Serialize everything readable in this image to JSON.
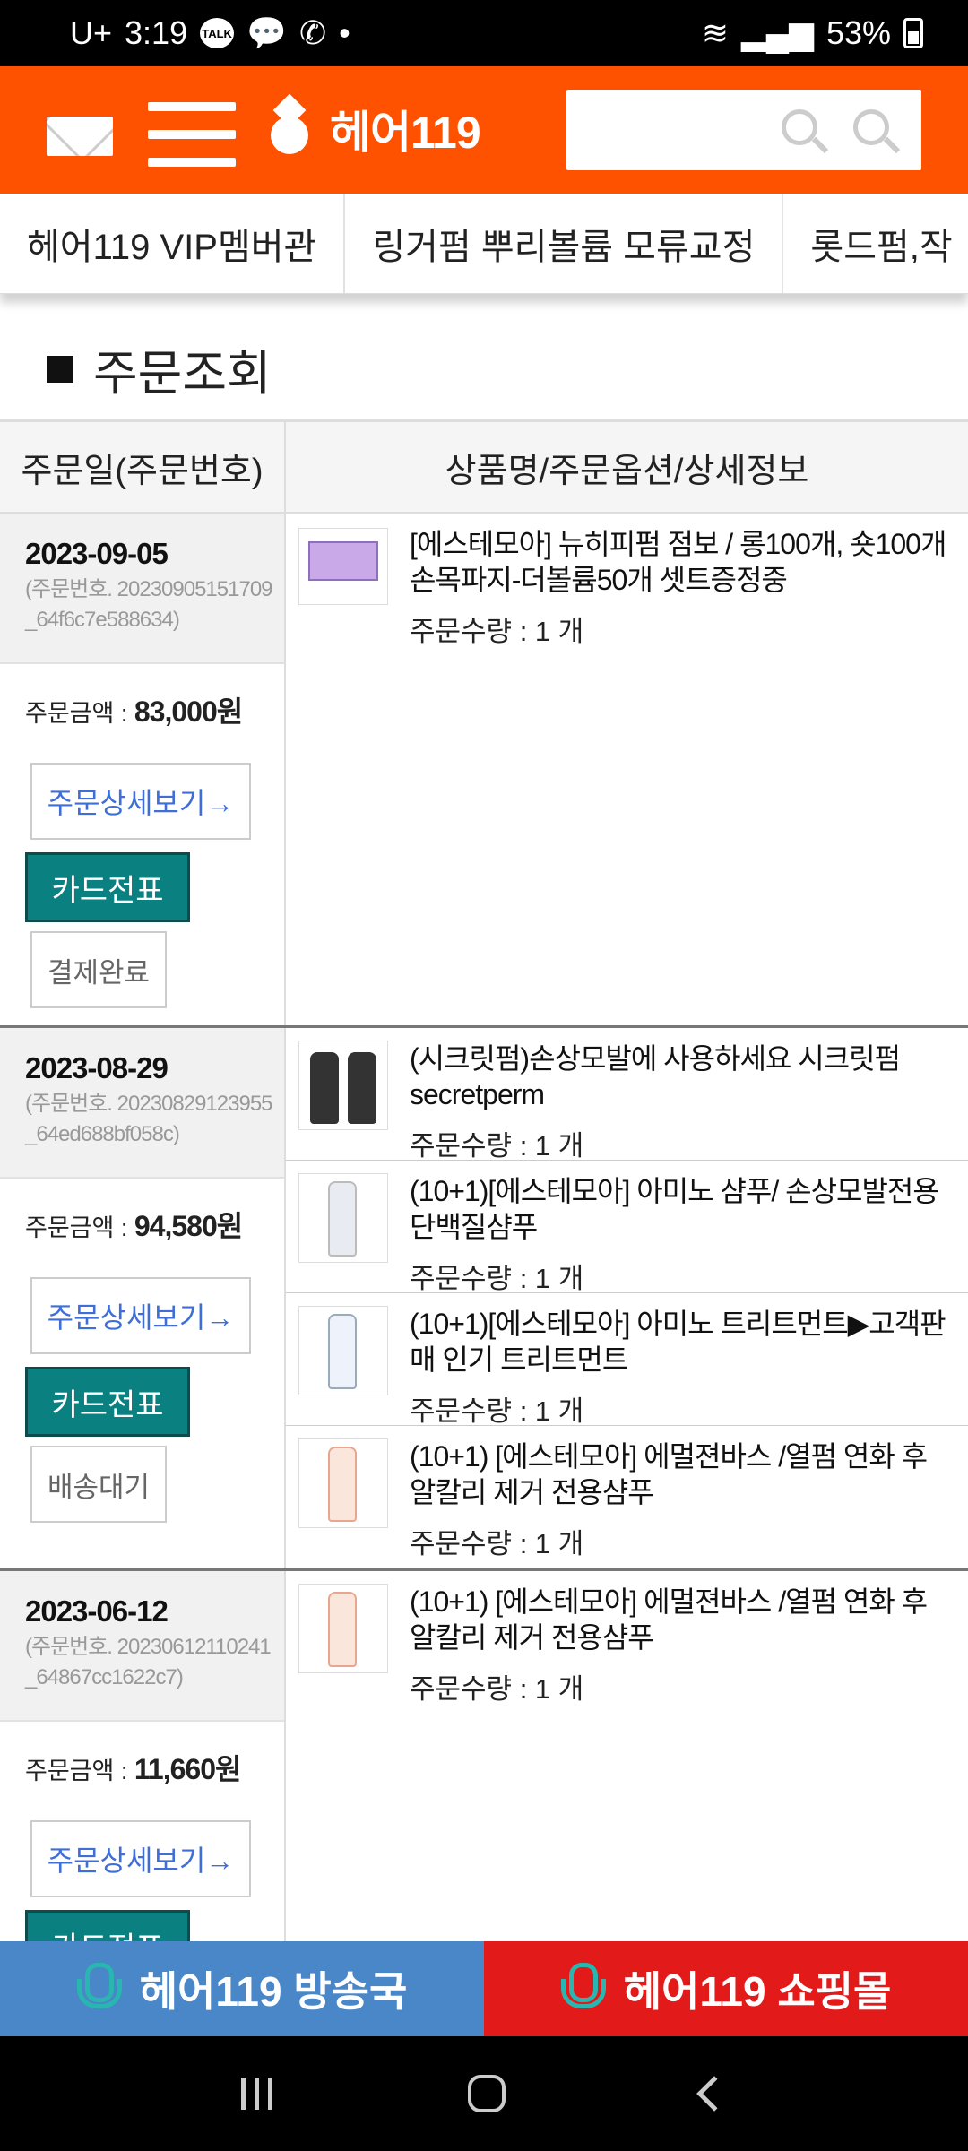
{
  "status_bar": {
    "carrier": "U+",
    "time": "3:19",
    "talk_badge": "TALK",
    "dot": "•",
    "battery": "53%"
  },
  "header": {
    "logo_text": "헤어119",
    "search_placeholder": ""
  },
  "categories": [
    "헤어119 VIP멤버관",
    "링거펌 뿌리볼륨 모류교정",
    "롯드펌,작"
  ],
  "page_title": "주문조회",
  "table": {
    "col_order": "주문일(주문번호)",
    "col_product": "상품명/주문옵션/상세정보"
  },
  "orders": [
    {
      "date": "2023-09-05",
      "order_number": "(주문번호. 20230905151709_64f6c7e588634)",
      "amount_label": "주문금액 : ",
      "amount": "83,000원",
      "detail_button": "주문상세보기→",
      "card_button": "카드전표",
      "status": "결제완료",
      "items": [
        {
          "name": "[에스테모아] 뉴히피펌 점보 / 롱100개, 숏100개 손목파지-더볼륨50개 셋트증정중",
          "qty": "주문수량 : 1 개"
        }
      ]
    },
    {
      "date": "2023-08-29",
      "order_number": "(주문번호. 20230829123955_64ed688bf058c)",
      "amount_label": "주문금액 : ",
      "amount": "94,580원",
      "detail_button": "주문상세보기→",
      "card_button": "카드전표",
      "status": "배송대기",
      "items": [
        {
          "name": "(시크릿펌)손상모발에 사용하세요 시크릿펌 secretperm",
          "qty": "주문수량 : 1 개"
        },
        {
          "name": "(10+1)[에스테모아] 아미노 샴푸/ 손상모발전용 단백질샴푸",
          "qty": "주문수량 : 1 개"
        },
        {
          "name": "(10+1)[에스테모아] 아미노 트리트먼트▶고객판매 인기 트리트먼트",
          "qty": "주문수량 : 1 개"
        },
        {
          "name": "(10+1) [에스테모아] 에멀젼바스 /열펌 연화 후 알칼리 제거 전용샴푸",
          "qty": "주문수량 : 1 개"
        }
      ]
    },
    {
      "date": "2023-06-12",
      "order_number": "(주문번호. 20230612110241_64867cc1622c7)",
      "amount_label": "주문금액 : ",
      "amount": "11,660원",
      "detail_button": "주문상세보기→",
      "card_button": "카드전표",
      "items": [
        {
          "name": "(10+1) [에스테모아] 에멀젼바스 /열펌 연화 후 알칼리 제거 전용샴푸",
          "qty": "주문수량 : 1 개"
        }
      ]
    }
  ],
  "bottom_bar": {
    "left": "헤어119 방송국",
    "right": "헤어119 쇼핑몰"
  },
  "colors": {
    "header": "#ff5200",
    "card_button": "#0a8080",
    "bottom_left": "#4a87c8",
    "bottom_right": "#e21a1a"
  }
}
